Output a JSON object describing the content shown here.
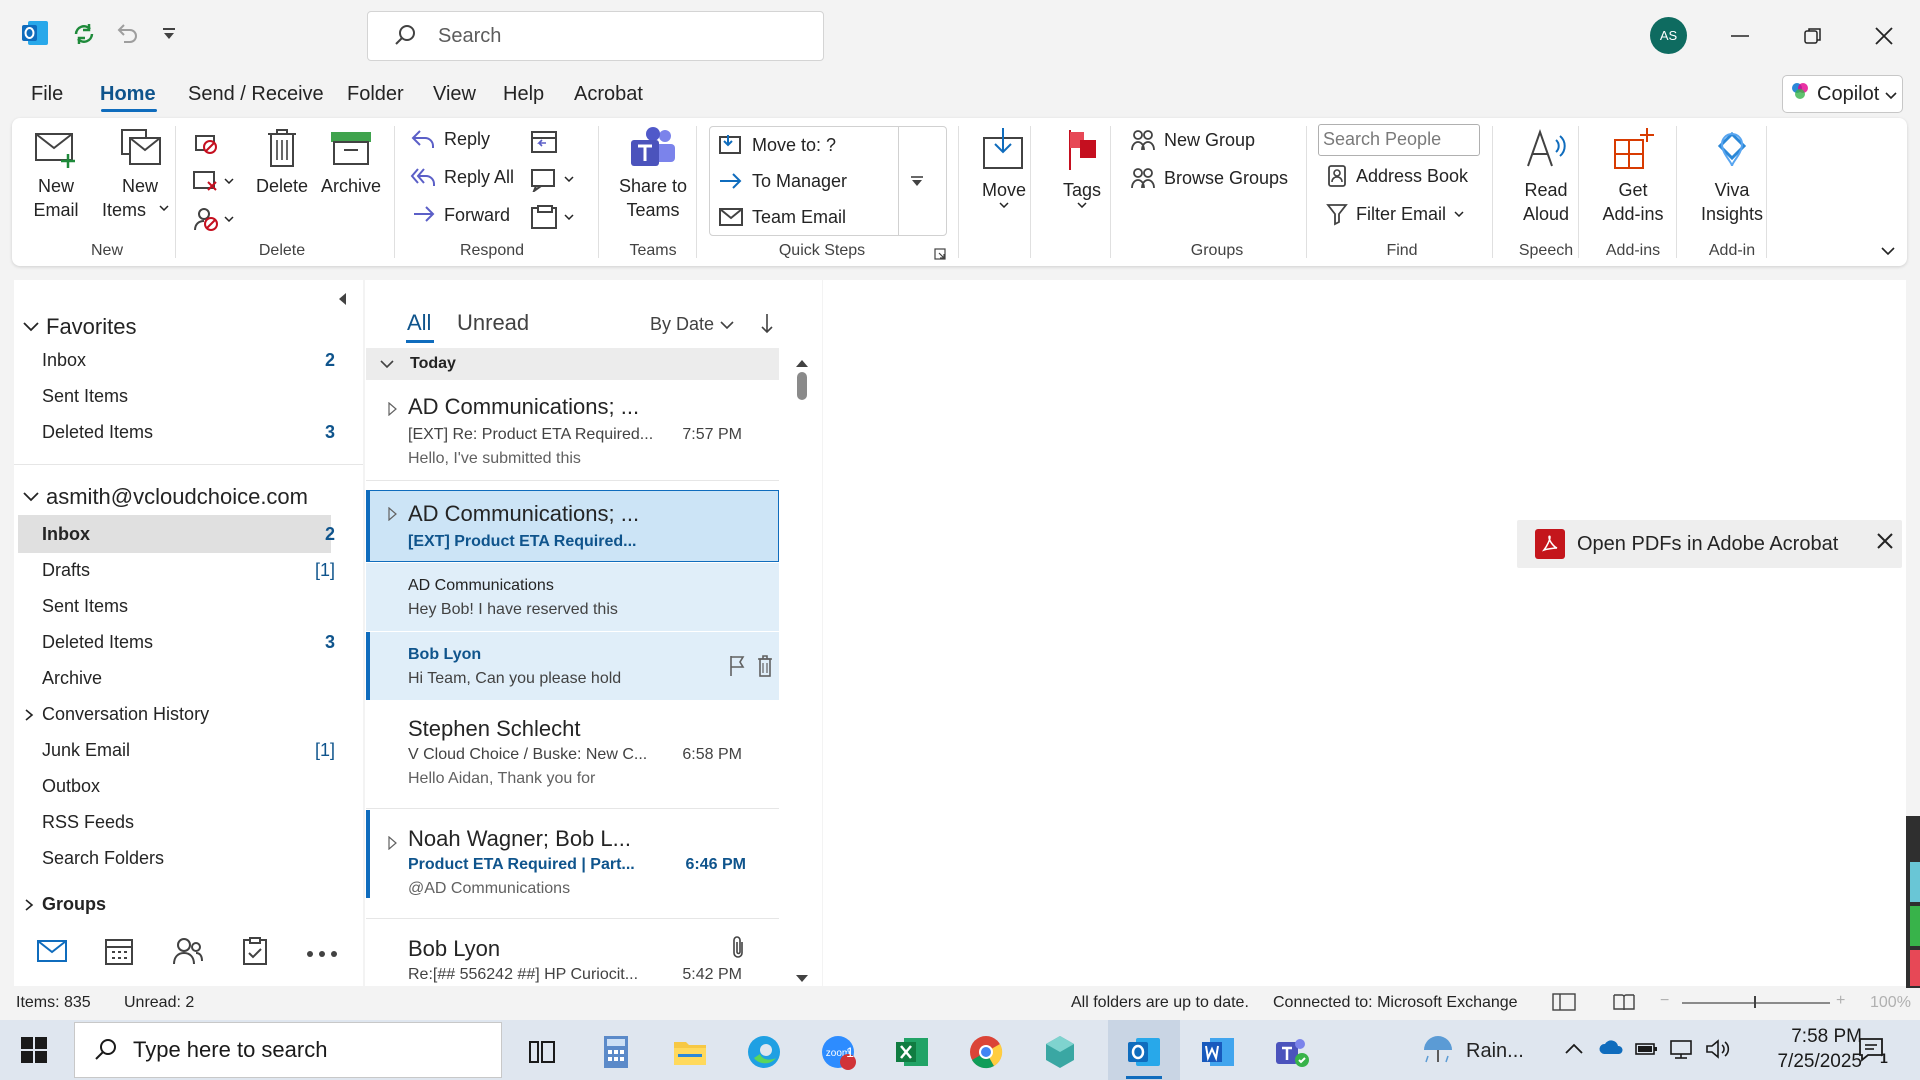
{
  "titlebar": {
    "search_placeholder": "Search",
    "avatar_initials": "AS"
  },
  "menu": {
    "tabs": [
      "File",
      "Home",
      "Send / Receive",
      "Folder",
      "View",
      "Help",
      "Acrobat"
    ],
    "active": "Home",
    "copilot_label": "Copilot"
  },
  "ribbon": {
    "new": {
      "new_email": "New\nEmail",
      "new_email_l1": "New",
      "new_email_l2": "Email",
      "new_items_l1": "New",
      "new_items_l2": "Items",
      "group": "New"
    },
    "delete": {
      "delete": "Delete",
      "archive": "Archive",
      "group": "Delete"
    },
    "respond": {
      "reply": "Reply",
      "reply_all": "Reply All",
      "forward": "Forward",
      "group": "Respond"
    },
    "teams": {
      "share_l1": "Share to",
      "share_l2": "Teams",
      "group": "Teams"
    },
    "quick_steps": {
      "items": [
        "Move to: ?",
        "To Manager",
        "Team Email"
      ],
      "group": "Quick Steps"
    },
    "move": {
      "label": "Move"
    },
    "tags": {
      "label": "Tags"
    },
    "groups": {
      "new_group": "New Group",
      "browse_groups": "Browse Groups",
      "group": "Groups"
    },
    "find": {
      "search_people_placeholder": "Search People",
      "address_book": "Address Book",
      "filter_email": "Filter Email",
      "group": "Find"
    },
    "speech": {
      "read_l1": "Read",
      "read_l2": "Aloud",
      "group": "Speech"
    },
    "addins": {
      "get_l1": "Get",
      "get_l2": "Add-ins",
      "group": "Add-ins"
    },
    "addin": {
      "viva_l1": "Viva",
      "viva_l2": "Insights",
      "group": "Add-in"
    }
  },
  "favorites": {
    "title": "Favorites",
    "items": [
      {
        "label": "Inbox",
        "count": "2"
      },
      {
        "label": "Sent Items",
        "count": ""
      },
      {
        "label": "Deleted Items",
        "count": "3"
      }
    ]
  },
  "account": {
    "title": "asmith@vcloudchoice.com",
    "items": [
      {
        "label": "Inbox",
        "count": "2"
      },
      {
        "label": "Drafts",
        "count": "[1]"
      },
      {
        "label": "Sent Items",
        "count": ""
      },
      {
        "label": "Deleted Items",
        "count": "3"
      },
      {
        "label": "Archive",
        "count": ""
      },
      {
        "label": "Conversation History",
        "count": ""
      },
      {
        "label": "Junk Email",
        "count": "[1]"
      },
      {
        "label": "Outbox",
        "count": ""
      },
      {
        "label": "RSS Feeds",
        "count": ""
      },
      {
        "label": "Search Folders",
        "count": ""
      }
    ],
    "groups_label": "Groups"
  },
  "message_list": {
    "filter_all": "All",
    "filter_unread": "Unread",
    "sort_label": "By Date",
    "group_today": "Today",
    "messages": [
      {
        "sender": "AD Communications; ...",
        "subject": "[EXT] Re: Product ETA Required...",
        "time": "7:57 PM",
        "preview": "Hello,  I've submitted this"
      },
      {
        "sender": "AD Communications; ...",
        "subject": "[EXT] Product ETA Required...",
        "time": "",
        "preview": ""
      },
      {
        "sender": "AD Communications",
        "subject": "",
        "time": "",
        "preview": "Hey Bob!  I have reserved this"
      },
      {
        "sender": "Bob Lyon",
        "subject": "",
        "time": "",
        "preview": "Hi Team,  Can you please hold"
      },
      {
        "sender": "Stephen Schlecht",
        "subject": "V Cloud Choice / Buske: New C...",
        "time": "6:58 PM",
        "preview": "Hello Aidan,  Thank you for"
      },
      {
        "sender": "Noah Wagner;  Bob L...",
        "subject": "Product ETA Required | Part...",
        "time": "6:46 PM",
        "preview": "@AD Communications"
      },
      {
        "sender": "Bob Lyon",
        "subject": "Re:[## 556242 ##] HP Curiocit...",
        "time": "5:42 PM",
        "preview": ""
      }
    ]
  },
  "reading_pane": {
    "acrobat_banner": "Open PDFs in Adobe Acrobat"
  },
  "statusbar": {
    "items": "Items: 835",
    "unread": "Unread: 2",
    "sync": "All folders are up to date.",
    "connection": "Connected to: Microsoft Exchange",
    "zoom": "100%"
  },
  "taskbar": {
    "search_placeholder": "Type here to search",
    "weather": "Rain...",
    "time": "7:58 PM",
    "date": "7/25/2025",
    "notification_count": "1",
    "zoom_badge": "1"
  },
  "colors": {
    "accent": "#0f6cbd",
    "selected_bg": "#cce4f6",
    "selected_border": "#0f6cbd"
  }
}
